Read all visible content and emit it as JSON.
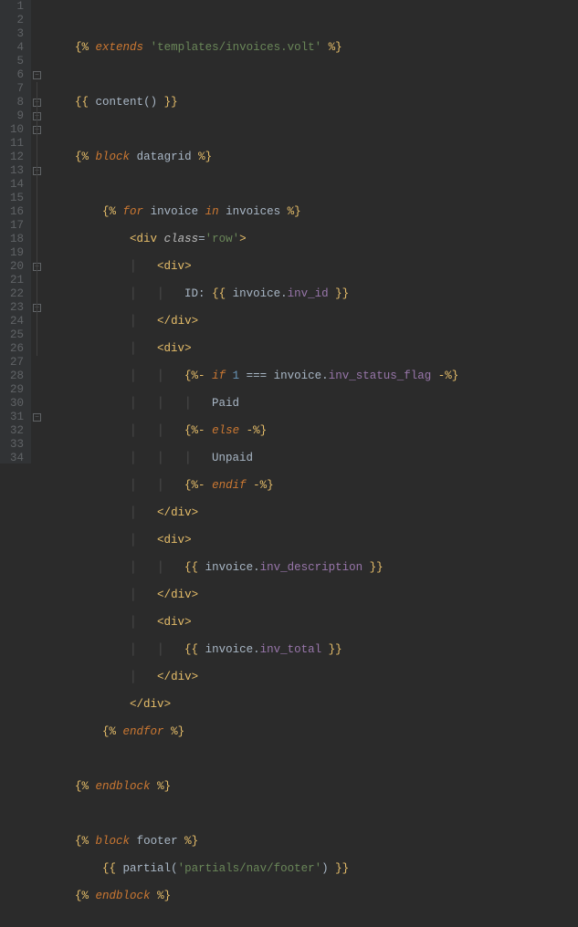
{
  "lines": {
    "l1": {
      "n": "1"
    },
    "l2": {
      "n": "2",
      "extends": "extends",
      "tpl": "'templates/invoices.volt'"
    },
    "l3": {
      "n": "3"
    },
    "l4": {
      "n": "4",
      "content": "content"
    },
    "l5": {
      "n": "5"
    },
    "l6": {
      "n": "6",
      "block": "block",
      "name": "datagrid"
    },
    "l7": {
      "n": "7"
    },
    "l8": {
      "n": "8",
      "for": "for",
      "var": "invoice",
      "in": "in",
      "coll": "invoices"
    },
    "l9": {
      "n": "9",
      "div": "div",
      "class_kw": "class",
      "class_val": "'row'"
    },
    "l10": {
      "n": "10",
      "div": "div"
    },
    "l11": {
      "n": "11",
      "id": "ID:",
      "inv": "invoice",
      "prop": "inv_id"
    },
    "l12": {
      "n": "12",
      "div": "div"
    },
    "l13": {
      "n": "13",
      "div": "div"
    },
    "l14": {
      "n": "14",
      "if": "if",
      "one": "1",
      "inv": "invoice",
      "prop": "inv_status_flag"
    },
    "l15": {
      "n": "15",
      "txt": "Paid"
    },
    "l16": {
      "n": "16",
      "else": "else"
    },
    "l17": {
      "n": "17",
      "txt": "Unpaid"
    },
    "l18": {
      "n": "18",
      "endif": "endif"
    },
    "l19": {
      "n": "19",
      "div": "div"
    },
    "l20": {
      "n": "20",
      "div": "div"
    },
    "l21": {
      "n": "21",
      "inv": "invoice",
      "prop": "inv_description"
    },
    "l22": {
      "n": "22",
      "div": "div"
    },
    "l23": {
      "n": "23",
      "div": "div"
    },
    "l24": {
      "n": "24",
      "inv": "invoice",
      "prop": "inv_total"
    },
    "l25": {
      "n": "25",
      "div": "div"
    },
    "l26": {
      "n": "26",
      "div": "div"
    },
    "l27": {
      "n": "27",
      "endfor": "endfor"
    },
    "l28": {
      "n": "28"
    },
    "l29": {
      "n": "29",
      "endblock": "endblock"
    },
    "l30": {
      "n": "30"
    },
    "l31": {
      "n": "31",
      "block": "block",
      "name": "footer"
    },
    "l32": {
      "n": "32",
      "partial": "partial",
      "arg": "'partials/nav/footer'"
    },
    "l33": {
      "n": "33",
      "endblock": "endblock"
    },
    "l34": {
      "n": "34"
    }
  },
  "delims": {
    "stmt_o": "{%",
    "stmt_c": "%}",
    "out_o": "{{",
    "out_c": "}}",
    "trim_o": "{%-",
    "trim_c": "-%}"
  },
  "ops": {
    "eq": "===",
    "dot": ".",
    "lt": "<",
    "gt": ">",
    "slash": "/",
    "lp": "(",
    "rp": ")"
  }
}
